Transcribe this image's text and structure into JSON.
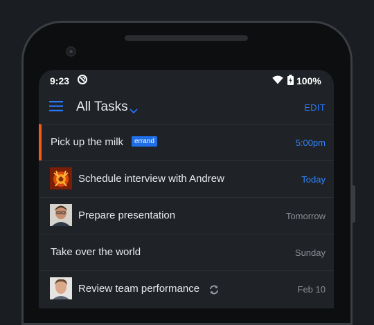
{
  "status_bar": {
    "time": "9:23",
    "battery": "100%"
  },
  "app_bar": {
    "title": "All Tasks",
    "edit_label": "EDIT"
  },
  "colors": {
    "accent": "#2979ff",
    "highlight_bar": "#f05a1a",
    "tag_bg": "#1e6fe8"
  },
  "tasks": [
    {
      "title": "Pick up the milk",
      "tag": "errand",
      "due": "5:00pm",
      "icon": "none"
    },
    {
      "title": "Schedule interview with Andrew",
      "due": "Today",
      "icon": "flame-avatar"
    },
    {
      "title": "Prepare presentation",
      "due": "Tomorrow",
      "icon": "person-avatar"
    },
    {
      "title": "Take over the world",
      "due": "Sunday",
      "icon": "none"
    },
    {
      "title": "Review team performance",
      "due": "Feb 10",
      "icon": "person-avatar",
      "repeat": "repeat-icon"
    }
  ]
}
